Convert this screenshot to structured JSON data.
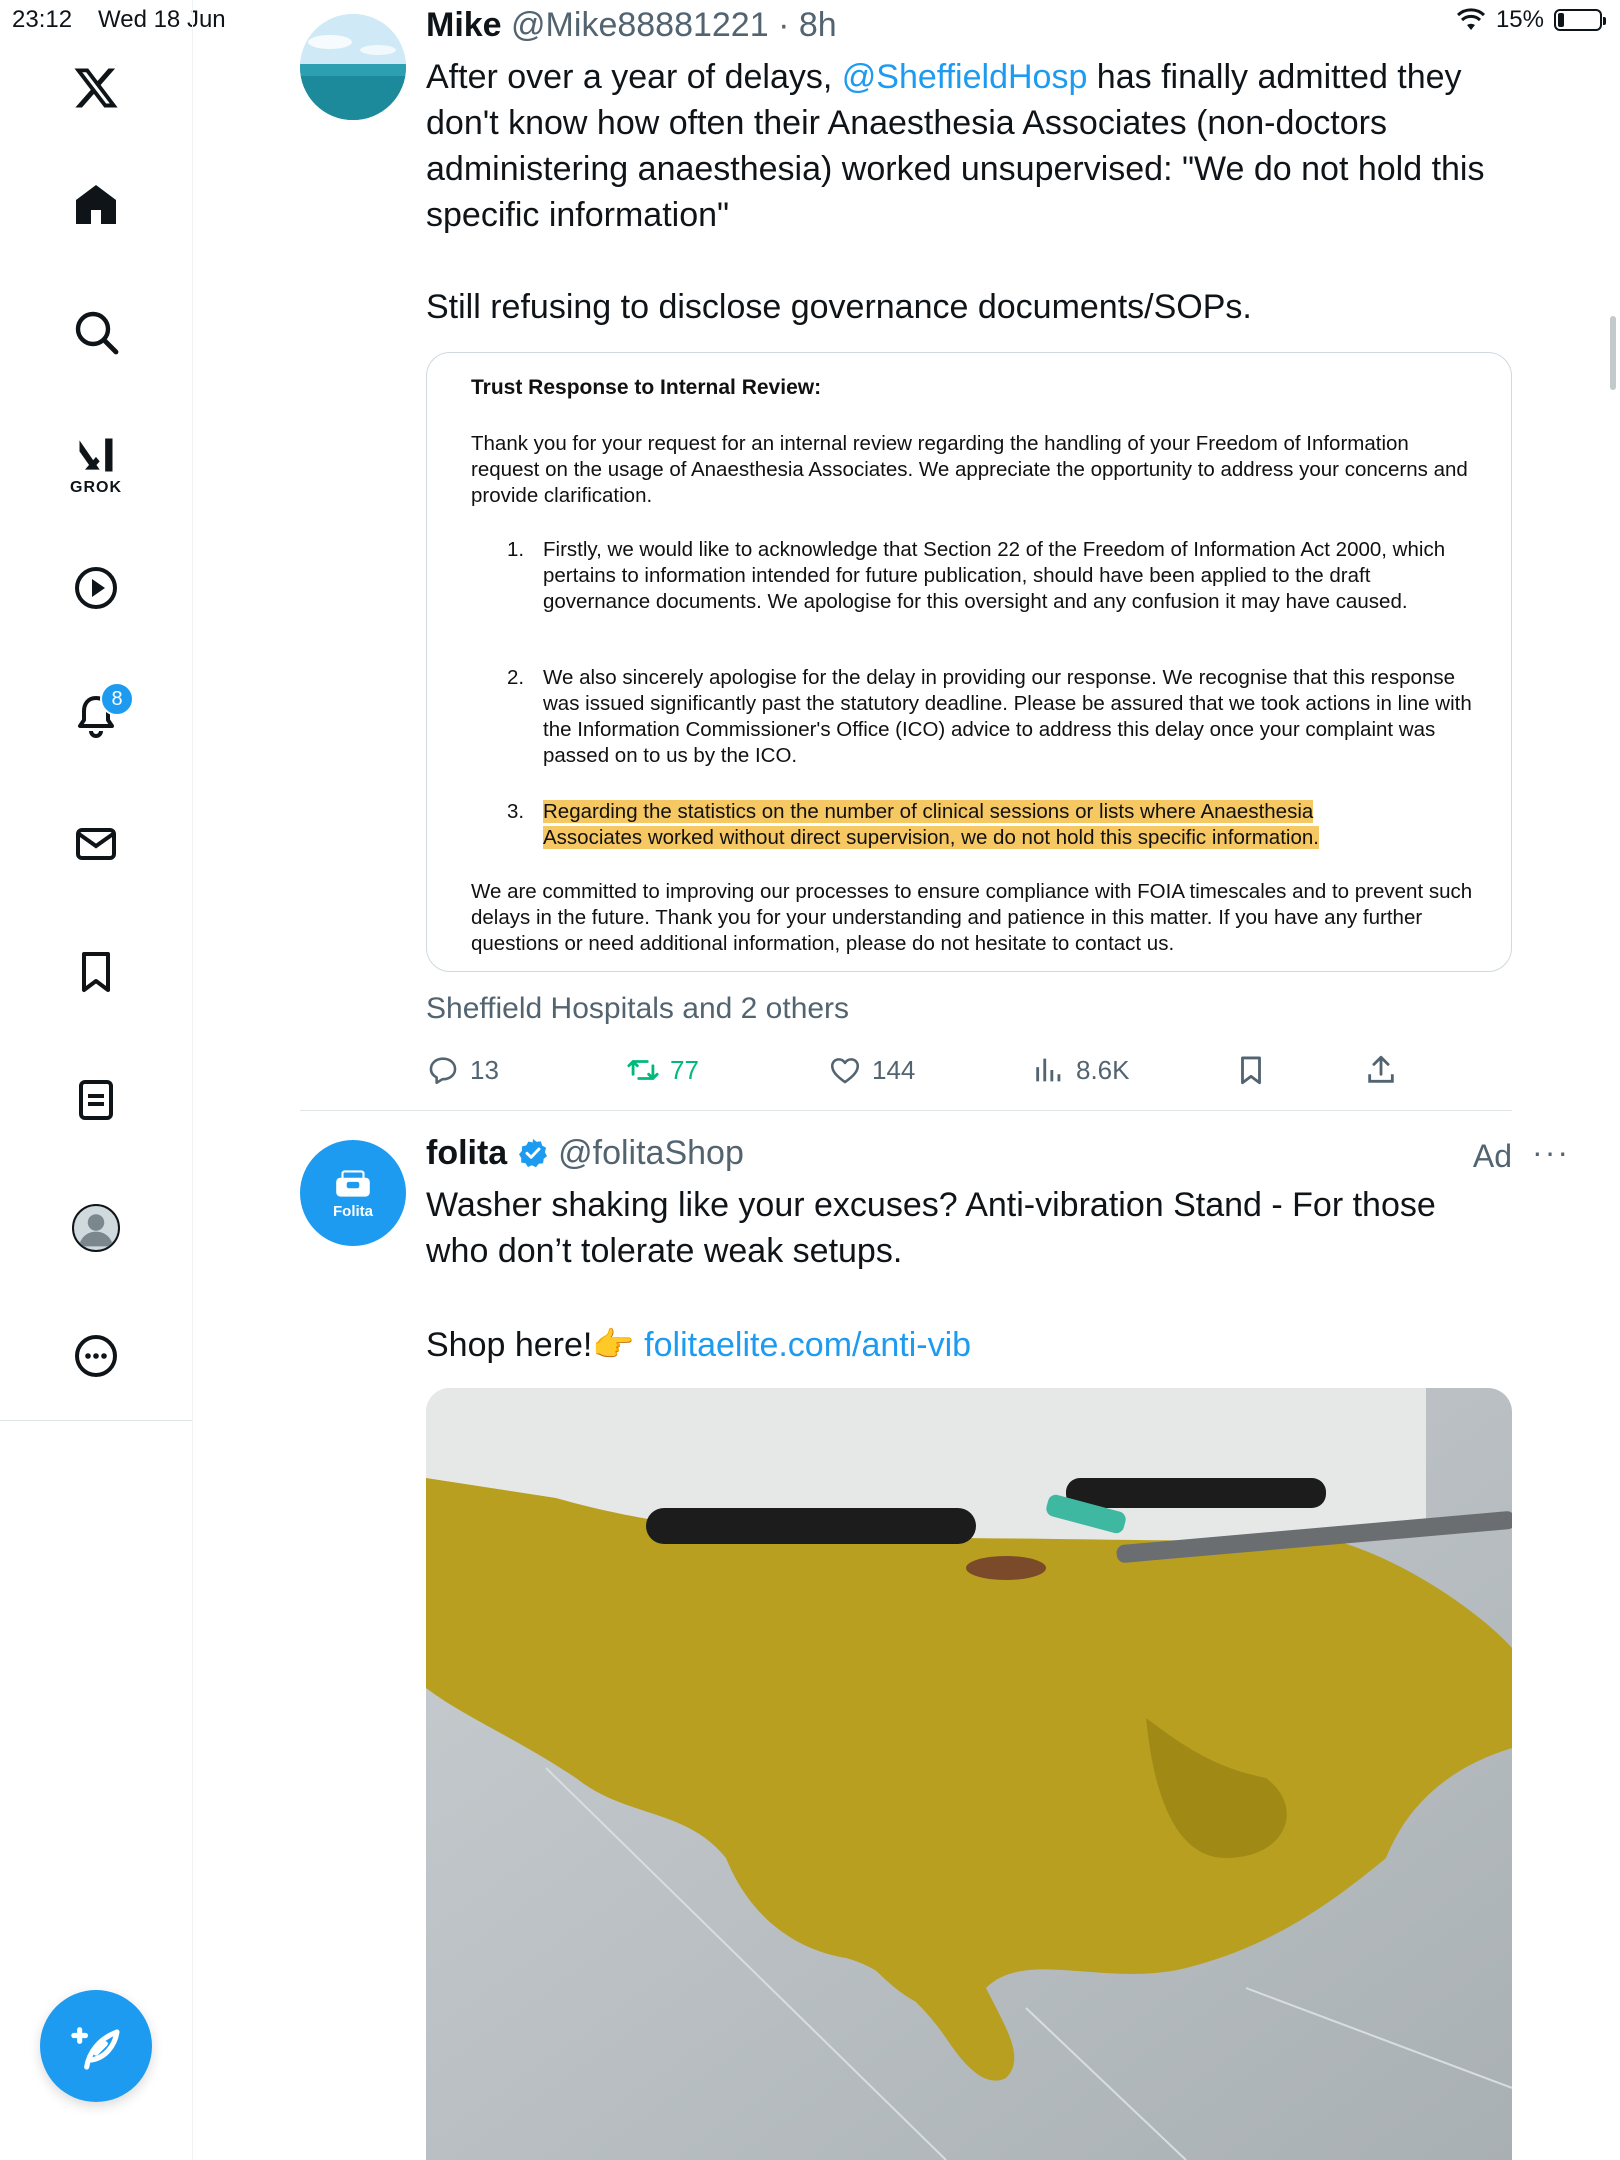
{
  "status_bar": {
    "time": "23:12",
    "date": "Wed 18 Jun",
    "battery": "15%",
    "battery_level": 0.15
  },
  "sidebar": {
    "items": [
      {
        "name": "home",
        "label": ""
      },
      {
        "name": "explore",
        "label": ""
      },
      {
        "name": "grok",
        "label": "GROK"
      },
      {
        "name": "videos",
        "label": ""
      },
      {
        "name": "notifications",
        "label": "",
        "badge": "8"
      },
      {
        "name": "messages",
        "label": ""
      },
      {
        "name": "bookmarks",
        "label": ""
      },
      {
        "name": "lists",
        "label": ""
      },
      {
        "name": "profile",
        "label": ""
      },
      {
        "name": "more",
        "label": ""
      }
    ]
  },
  "tweet": {
    "author_name": "Mike",
    "author_handle": "@Mike88881221",
    "separator": "·",
    "time_ago": "8h",
    "text_before_mention": "After over a year of delays, ",
    "mention": "@SheffieldHosp",
    "text_after_mention": " has finally admitted they don't know how often their Anaesthesia Associates (non-doctors administering anaesthesia) worked unsupervised: \"We do not hold this specific information\"",
    "text_second_paragraph": "Still refusing to disclose governance documents/SOPs.",
    "document": {
      "title": "Trust Response to Internal Review:",
      "intro": "Thank you for your request for an internal review regarding the handling of your Freedom of Information request on the usage of Anaesthesia Associates. We appreciate the opportunity to address your concerns and provide clarification.",
      "items": [
        {
          "num": "1.",
          "text": "Firstly, we would like to acknowledge that Section 22 of the Freedom of Information Act 2000, which pertains to information intended for future publication, should have been applied to the draft governance documents. We apologise for this oversight and any confusion it may have caused."
        },
        {
          "num": "2.",
          "text": "We also sincerely apologise for the delay in providing our response. We recognise that this response was issued significantly past the statutory deadline. Please be assured that we took actions in line with the Information Commissioner's Office (ICO) advice to address this delay once your complaint was passed on to us by the ICO."
        },
        {
          "num": "3.",
          "text": "Regarding the statistics on the number of clinical sessions or lists where Anaesthesia Associates worked without direct supervision, we do not hold this specific information."
        }
      ],
      "closing": "We are committed to improving our processes to ensure compliance with FOIA timescales and to prevent such delays in the future. Thank you for your understanding and patience in this matter. If you have any further questions or need additional information, please do not hesitate to contact us."
    },
    "liked_by": "Sheffield Hospitals and 2 others",
    "stats": {
      "replies": "13",
      "reposts": "77",
      "likes": "144",
      "views": "8.6K"
    }
  },
  "ad": {
    "author_name": "folita",
    "author_handle": "@folitaShop",
    "avatar_text": "Folita",
    "ad_label": "Ad",
    "more": "···",
    "text": "Washer shaking like your excuses? Anti-vibration Stand - For those who don’t tolerate weak setups.",
    "shop_text": "Shop here!",
    "shop_emoji": "👉",
    "link": "folitaelite.com/anti-vib"
  },
  "colors": {
    "accent": "#1d9bf0",
    "repost_active": "#00ba7c",
    "secondary_text": "#536471",
    "highlight": "#f6c863"
  }
}
